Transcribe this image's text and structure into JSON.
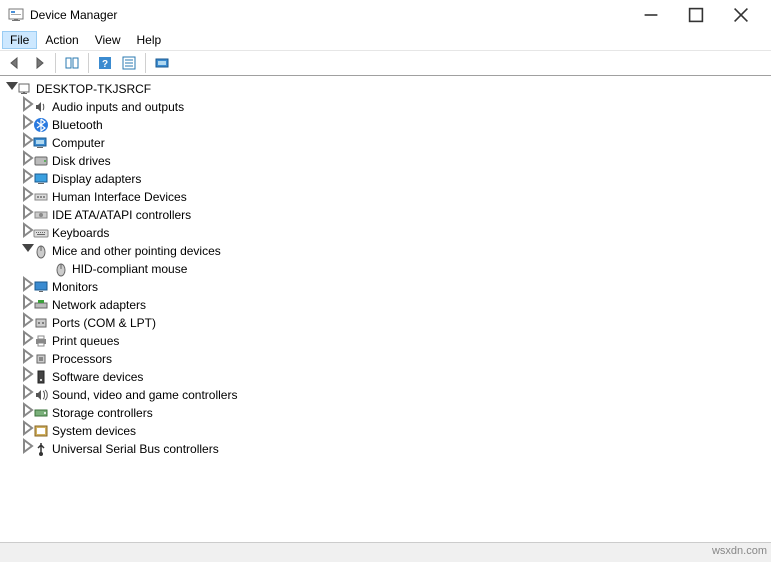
{
  "window": {
    "title": "Device Manager"
  },
  "menu": {
    "file": "File",
    "action": "Action",
    "view": "View",
    "help": "Help"
  },
  "tree": {
    "root": "DESKTOP-TKJSRCF",
    "items": [
      {
        "label": "Audio inputs and outputs",
        "icon": "speaker"
      },
      {
        "label": "Bluetooth",
        "icon": "bluetooth"
      },
      {
        "label": "Computer",
        "icon": "computer"
      },
      {
        "label": "Disk drives",
        "icon": "disk"
      },
      {
        "label": "Display adapters",
        "icon": "display"
      },
      {
        "label": "Human Interface Devices",
        "icon": "hid"
      },
      {
        "label": "IDE ATA/ATAPI controllers",
        "icon": "ide"
      },
      {
        "label": "Keyboards",
        "icon": "keyboard"
      },
      {
        "label": "Mice and other pointing devices",
        "icon": "mouse",
        "expanded": true,
        "children": [
          {
            "label": "HID-compliant mouse",
            "icon": "mouse"
          }
        ]
      },
      {
        "label": "Monitors",
        "icon": "monitor"
      },
      {
        "label": "Network adapters",
        "icon": "network"
      },
      {
        "label": "Ports (COM & LPT)",
        "icon": "port"
      },
      {
        "label": "Print queues",
        "icon": "printer"
      },
      {
        "label": "Processors",
        "icon": "cpu"
      },
      {
        "label": "Software devices",
        "icon": "software"
      },
      {
        "label": "Sound, video and game controllers",
        "icon": "sound"
      },
      {
        "label": "Storage controllers",
        "icon": "storage"
      },
      {
        "label": "System devices",
        "icon": "system"
      },
      {
        "label": "Universal Serial Bus controllers",
        "icon": "usb"
      }
    ]
  },
  "statusbar": {
    "text": "wsxdn.com"
  }
}
